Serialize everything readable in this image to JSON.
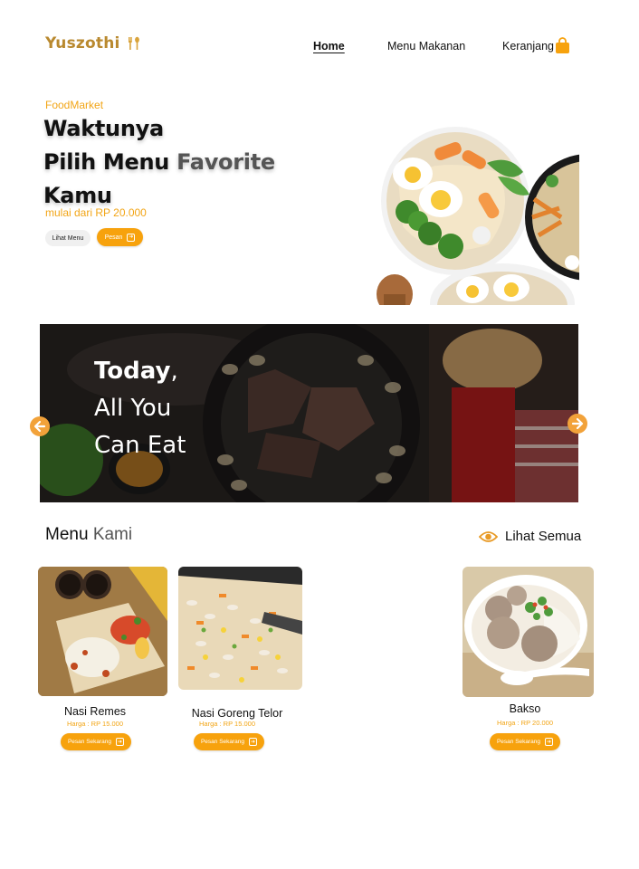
{
  "brand": {
    "name": "Yuszothi",
    "icon": "fork-spoon-icon",
    "color": "#b9892f"
  },
  "nav": {
    "home": "Home",
    "menu": "Menu Makanan",
    "cart": "Keranjang",
    "cart_icon": "shopping-bag-icon"
  },
  "hero": {
    "tag": "FoodMarket",
    "title_line1": "Waktunya",
    "title_line2a": "Pilih Menu ",
    "title_line2b": "Favorite",
    "title_line3": "Kamu",
    "subtitle": "mulai dari RP 20.000",
    "btn_menu": "Lihat Menu",
    "btn_order": "Pesan"
  },
  "banner": {
    "line1_bold": "Today",
    "line1_rest": ",",
    "line2": "All You",
    "line3": "Can Eat"
  },
  "menu": {
    "title_a": "Menu ",
    "title_b": "Kami",
    "see_all": "Lihat Semua",
    "see_all_icon": "eye-icon",
    "items": [
      {
        "name": "Nasi Remes",
        "price": "Harga : RP 15.000",
        "button": "Pesan Sekarang"
      },
      {
        "name": "Nasi Goreng Telor",
        "price": "Harga : RP 15.000",
        "button": "Pesan Sekarang"
      },
      {
        "name": "Bakso",
        "price": "Harga : RP 20.000",
        "button": "Pesan Sekarang"
      }
    ]
  },
  "colors": {
    "accent": "#f7a20d",
    "accent_text": "#f2a516",
    "arrow": "#f2a23a"
  }
}
